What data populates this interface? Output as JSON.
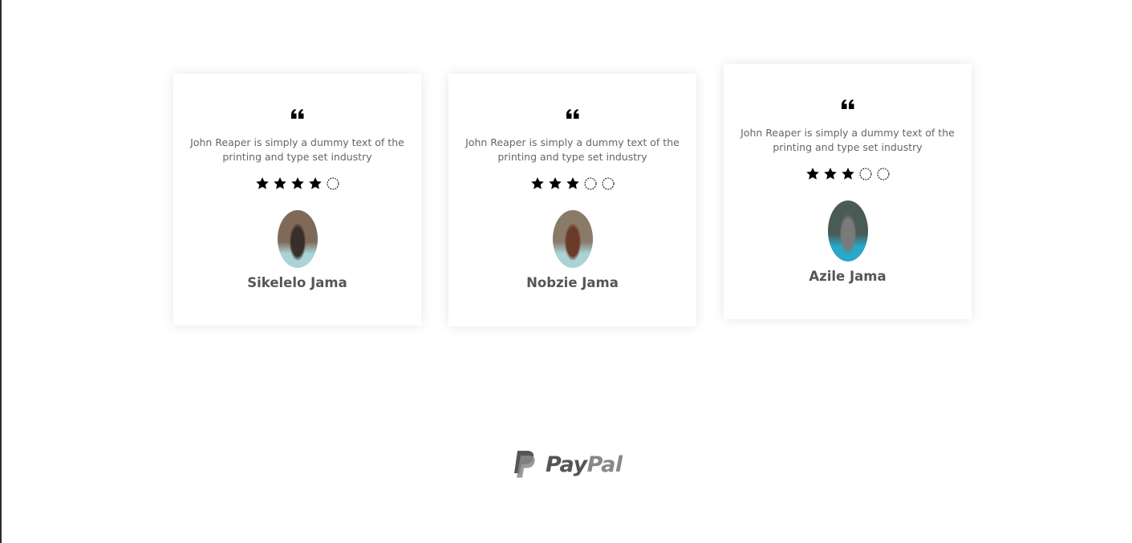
{
  "testimonials": [
    {
      "quote": "John Reaper is simply a dummy text of the printing and type set industry",
      "rating": 4,
      "max_rating": 5,
      "name": "Sikelelo Jama",
      "avatar_colors": [
        "#7f6a5a",
        "#a9d3d6",
        "#3a2e2a"
      ]
    },
    {
      "quote": "John Reaper is simply a dummy text of the printing and type set industry",
      "rating": 3,
      "max_rating": 5,
      "name": "Nobzie Jama",
      "avatar_colors": [
        "#8a7a68",
        "#a9d3d6",
        "#6b3a28"
      ]
    },
    {
      "quote": "John Reaper is simply a dummy text of the printing and type set industry",
      "rating": 3,
      "max_rating": 5,
      "name": "Azile Jama",
      "avatar_colors": [
        "#4a5a55",
        "#2aa7c9",
        "#7a7a7a"
      ]
    }
  ],
  "footer": {
    "logo_text_pay": "Pay",
    "logo_text_pal": "Pal"
  },
  "colors": {
    "text_muted": "#666666",
    "name": "#555555",
    "star": "#000000",
    "logo": "#555555"
  }
}
